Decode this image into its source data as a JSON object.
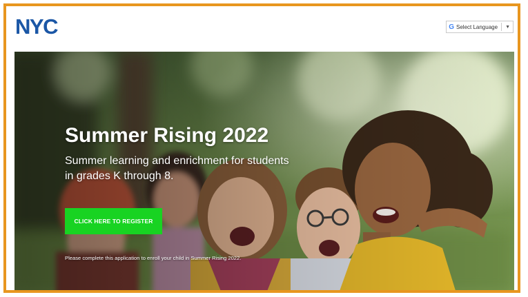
{
  "header": {
    "logo_text": "NYC",
    "language_selector": {
      "icon": "google-g-icon",
      "label": "Select Language",
      "arrow": "▼"
    }
  },
  "hero": {
    "title": "Summer Rising 2022",
    "subtitle": "Summer learning and enrichment for students in grades K through 8.",
    "cta_label": "CLICK HERE TO REGISTER",
    "note": "Please complete this application to enroll your child in Summer Rising 2022."
  },
  "colors": {
    "frame_border": "#e8961f",
    "logo": "#1b57a6",
    "cta_background": "#18d322",
    "text": "#ffffff"
  }
}
